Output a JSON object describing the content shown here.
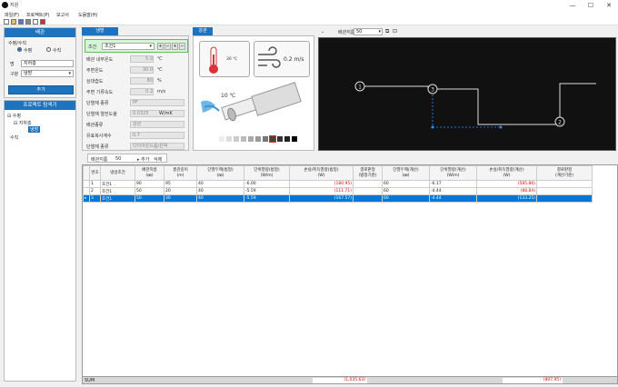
{
  "window": {
    "title": "지원",
    "controls": [
      "—",
      "☐",
      "✕"
    ]
  },
  "menu": [
    "파일(F)",
    "프로젝트(P)",
    "보고서",
    "도움말(H)"
  ],
  "toolbar_icons": [
    "new-icon",
    "open-icon",
    "save-icon",
    "print-icon",
    "edit-icon",
    "close-icon"
  ],
  "left_panel": {
    "header": "배관",
    "mode_label": "수평/수직",
    "radio_horizontal": "수평",
    "radio_vertical": "수직",
    "name_label": "명",
    "name_value": "지하층",
    "type_label": "구분",
    "type_value": "냉방",
    "add_button": "추가"
  },
  "project_panel": {
    "header": "프로젝트 탐색기",
    "tree": [
      "수평",
      "지하층",
      "냉방",
      "수직"
    ]
  },
  "cooling_panel": {
    "tab": "냉방",
    "condition_label": "조건",
    "condition_value": "조건1",
    "fields": [
      {
        "label": "배관 내부온도",
        "value": "5.0",
        "unit": "℃"
      },
      {
        "label": "주변온도",
        "value": "30.0",
        "unit": "℃"
      },
      {
        "label": "상대습도",
        "value": "80",
        "unit": "%"
      },
      {
        "label": "주변 기류속도",
        "value": "0.2",
        "unit": "m/s"
      },
      {
        "label": "단열재 종류",
        "value": "PF",
        "unit": ""
      },
      {
        "label": "단열재 열전도율",
        "value": "0.0325",
        "unit": "W/mK"
      },
      {
        "label": "배관종류",
        "value": "강관",
        "unit": ""
      },
      {
        "label": "유효복사계수",
        "value": "0.7",
        "unit": ""
      },
      {
        "label": "단열재 종류",
        "value": "다이아몬드폼/은박",
        "unit": ""
      }
    ]
  },
  "visual_panel": {
    "tab": "강관",
    "ambient_temp": "30 ℃",
    "wind_speed": "0.2 m/s",
    "inner_temp": "10 ℃"
  },
  "diagram_toolbar": {
    "label": "배관지름",
    "value": "50"
  },
  "diagram_nodes": [
    "1",
    "3",
    "2"
  ],
  "grid_toolbar": {
    "label": "배관지름",
    "value": "50",
    "add_button": "추가",
    "delete_button": "삭제"
  },
  "table": {
    "columns": [
      "번호",
      "냉방조건",
      "배관지름\n(㎜)",
      "총관길이\n(m)",
      "단열두께(법정)\n(㎜)",
      "단위열량(법정)\n(W/m)",
      "손실/취득열량(법정)\n(W)",
      "결로판정\n(법정기준)",
      "단열두께(계산)\n(㎜)",
      "단위열량(계산)\n(W/m)",
      "손실/취득열량(계산)\n(W)",
      "결로판정\n(계산기준)"
    ],
    "rows": [
      {
        "no": "1",
        "cond": "조건1",
        "dia": "90",
        "len": "95",
        "t1": "40",
        "q1": "-6.00",
        "loss1": "(180.95)",
        "c1": "",
        "t2": "60",
        "q2": "-6.17",
        "loss2": "(585.86)",
        "c2": ""
      },
      {
        "no": "2",
        "cond": "조건1",
        "dia": "50",
        "len": "20",
        "t1": "40",
        "q1": "-5.59",
        "loss1": "(111.71)",
        "c1": "",
        "t2": "60",
        "q2": "-4.44",
        "loss2": "(88.84)",
        "c2": ""
      },
      {
        "no": "3",
        "cond": "조건1",
        "dia": "50",
        "len": "30",
        "t1": "40",
        "q1": "-5.59",
        "loss1": "(167.57)",
        "c1": "",
        "t2": "60",
        "q2": "-4.44",
        "loss2": "(133.25)",
        "c2": ""
      }
    ],
    "selected_row": 2
  },
  "sum": {
    "label": "SUM",
    "loss1": "(1,035.63)",
    "loss2": "(807.95)"
  },
  "colors": {
    "accent": "#1e73be",
    "selection": "#0078d7",
    "negative": "#dd0000",
    "diagram_bg": "#111111"
  }
}
